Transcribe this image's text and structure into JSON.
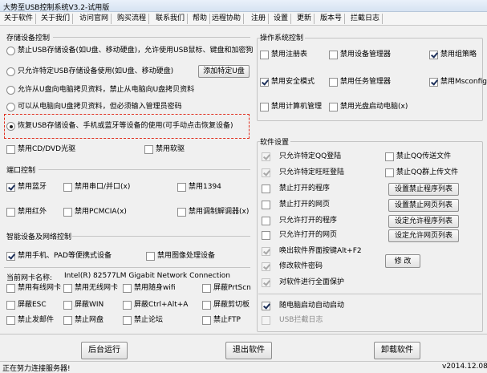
{
  "window": {
    "title": "大势至USB控制系统V3.2-试用版"
  },
  "menu": [
    "关于软件",
    "关于我们",
    "访问官网",
    "购买流程",
    "联系我们",
    "帮助",
    "远程协助",
    "注册",
    "设置",
    "更新",
    "版本号",
    "拦截日志"
  ],
  "storage": {
    "title": "存储设备控制",
    "radio1": "禁止USB存储设备(如U盘、移动硬盘)，允许使用USB鼠标、键盘和加密狗",
    "radio2": "只允许特定USB存储设备使用(如U盘、移动硬盘)",
    "add_button": "添加特定U盘",
    "radio3": "允许从U盘向电脑拷贝资料，禁止从电脑向U盘拷贝资料",
    "radio4": "可以从电脑向U盘拷贝资料，但必须输入管理员密码",
    "radio5": "恢复USB存储设备、手机或蓝牙等设备的使用(可手动点击恢复设备)",
    "cd": "禁用CD/DVD光驱",
    "floppy": "禁用软驱"
  },
  "ports": {
    "title": "端口控制",
    "bluetooth": "禁用蓝牙",
    "serial": "禁用串口/并口(x)",
    "p1394": "禁用1394",
    "infrared": "禁用红外",
    "pcmcia": "禁用PCMCIA(x)",
    "modem": "禁用调制解调器(x)"
  },
  "smart": {
    "title": "智能设备及网络控制",
    "phone": "禁用手机、PAD等便携式设备",
    "imaging": "禁用图像处理设备"
  },
  "network": {
    "nic_label": "当前网卡名称:",
    "nic_value": "Intel(R) 82577LM Gigabit Network Connection",
    "wired": "禁用有线网卡",
    "wireless": "禁用无线网卡",
    "portable_wifi": "禁用随身wifi",
    "prtscn": "屏蔽PrtScn",
    "esc": "屏蔽ESC",
    "win": "屏蔽WIN",
    "ctrl_alt_a": "屏蔽Ctrl+Alt+A",
    "clipboard": "屏蔽剪切板",
    "email": "禁止发邮件",
    "netdisk": "禁止网盘",
    "forum": "禁止论坛",
    "ftp": "禁止FTP"
  },
  "os": {
    "title": "操作系统控制",
    "registry": "禁用注册表",
    "devmgr": "禁用设备管理器",
    "gpedit": "禁用组策略",
    "safemode": "禁用安全模式",
    "taskmgr": "禁用任务管理器",
    "msconfig": "禁用Msconfig",
    "compmgmt": "禁用计算机管理",
    "cdboot": "禁用光盘启动电脑(x)"
  },
  "software": {
    "title": "软件设置",
    "qq_only": "只允许特定QQ登陆",
    "qq_file": "禁止QQ传送文件",
    "ww_only": "只允许特定旺旺登陆",
    "qq_group": "禁止QQ群上传文件",
    "block_prog": "禁止打开的程序",
    "block_prog_btn": "设置禁止程序列表",
    "block_web": "禁止打开的网页",
    "block_web_btn": "设置禁止网页列表",
    "allow_prog": "只允许打开的程序",
    "allow_prog_btn": "设定允许程序列表",
    "allow_web": "只允许打开的网页",
    "allow_web_btn": "设定允许网页列表",
    "hotkey": "唤出软件界面按键Alt+F2",
    "password": "修改软件密码",
    "modify_btn": "修 改",
    "protect": "对软件进行全面保护",
    "autostart": "随电脑启动自动启动",
    "usblog": "USB拦截日志"
  },
  "actions": {
    "background": "后台运行",
    "exit": "退出软件",
    "uninstall": "卸载软件"
  },
  "status": {
    "text": "正在努力连接服务器!",
    "version": "v2014.12.08"
  }
}
